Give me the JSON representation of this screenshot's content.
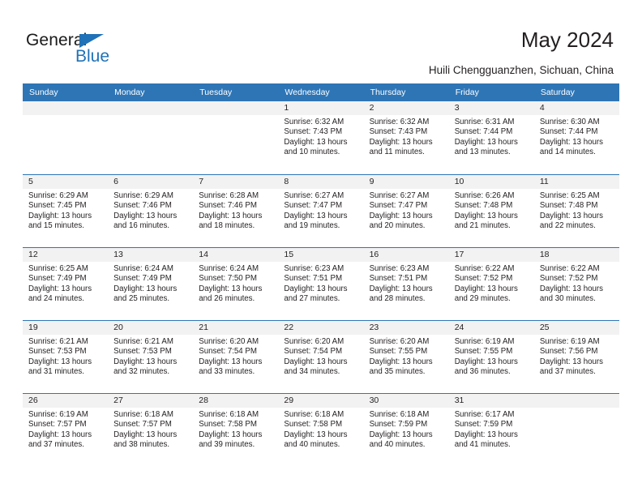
{
  "brand": {
    "name_top": "General",
    "name_bottom": "Blue",
    "accent_color": "#1f72b8"
  },
  "header": {
    "title": "May 2024",
    "subtitle": "Huili Chengguanzhen, Sichuan, China"
  },
  "theme": {
    "header_blue": "#2e75b6",
    "daynum_band": "#f2f2f2",
    "text": "#231f20"
  },
  "weekday_headers": [
    "Sunday",
    "Monday",
    "Tuesday",
    "Wednesday",
    "Thursday",
    "Friday",
    "Saturday"
  ],
  "weeks": [
    [
      {
        "day": "",
        "sunrise": "",
        "sunset": "",
        "daylight_line1": "",
        "daylight_line2": ""
      },
      {
        "day": "",
        "sunrise": "",
        "sunset": "",
        "daylight_line1": "",
        "daylight_line2": ""
      },
      {
        "day": "",
        "sunrise": "",
        "sunset": "",
        "daylight_line1": "",
        "daylight_line2": ""
      },
      {
        "day": "1",
        "sunrise": "Sunrise: 6:32 AM",
        "sunset": "Sunset: 7:43 PM",
        "daylight_line1": "Daylight: 13 hours",
        "daylight_line2": "and 10 minutes."
      },
      {
        "day": "2",
        "sunrise": "Sunrise: 6:32 AM",
        "sunset": "Sunset: 7:43 PM",
        "daylight_line1": "Daylight: 13 hours",
        "daylight_line2": "and 11 minutes."
      },
      {
        "day": "3",
        "sunrise": "Sunrise: 6:31 AM",
        "sunset": "Sunset: 7:44 PM",
        "daylight_line1": "Daylight: 13 hours",
        "daylight_line2": "and 13 minutes."
      },
      {
        "day": "4",
        "sunrise": "Sunrise: 6:30 AM",
        "sunset": "Sunset: 7:44 PM",
        "daylight_line1": "Daylight: 13 hours",
        "daylight_line2": "and 14 minutes."
      }
    ],
    [
      {
        "day": "5",
        "sunrise": "Sunrise: 6:29 AM",
        "sunset": "Sunset: 7:45 PM",
        "daylight_line1": "Daylight: 13 hours",
        "daylight_line2": "and 15 minutes."
      },
      {
        "day": "6",
        "sunrise": "Sunrise: 6:29 AM",
        "sunset": "Sunset: 7:46 PM",
        "daylight_line1": "Daylight: 13 hours",
        "daylight_line2": "and 16 minutes."
      },
      {
        "day": "7",
        "sunrise": "Sunrise: 6:28 AM",
        "sunset": "Sunset: 7:46 PM",
        "daylight_line1": "Daylight: 13 hours",
        "daylight_line2": "and 18 minutes."
      },
      {
        "day": "8",
        "sunrise": "Sunrise: 6:27 AM",
        "sunset": "Sunset: 7:47 PM",
        "daylight_line1": "Daylight: 13 hours",
        "daylight_line2": "and 19 minutes."
      },
      {
        "day": "9",
        "sunrise": "Sunrise: 6:27 AM",
        "sunset": "Sunset: 7:47 PM",
        "daylight_line1": "Daylight: 13 hours",
        "daylight_line2": "and 20 minutes."
      },
      {
        "day": "10",
        "sunrise": "Sunrise: 6:26 AM",
        "sunset": "Sunset: 7:48 PM",
        "daylight_line1": "Daylight: 13 hours",
        "daylight_line2": "and 21 minutes."
      },
      {
        "day": "11",
        "sunrise": "Sunrise: 6:25 AM",
        "sunset": "Sunset: 7:48 PM",
        "daylight_line1": "Daylight: 13 hours",
        "daylight_line2": "and 22 minutes."
      }
    ],
    [
      {
        "day": "12",
        "sunrise": "Sunrise: 6:25 AM",
        "sunset": "Sunset: 7:49 PM",
        "daylight_line1": "Daylight: 13 hours",
        "daylight_line2": "and 24 minutes."
      },
      {
        "day": "13",
        "sunrise": "Sunrise: 6:24 AM",
        "sunset": "Sunset: 7:49 PM",
        "daylight_line1": "Daylight: 13 hours",
        "daylight_line2": "and 25 minutes."
      },
      {
        "day": "14",
        "sunrise": "Sunrise: 6:24 AM",
        "sunset": "Sunset: 7:50 PM",
        "daylight_line1": "Daylight: 13 hours",
        "daylight_line2": "and 26 minutes."
      },
      {
        "day": "15",
        "sunrise": "Sunrise: 6:23 AM",
        "sunset": "Sunset: 7:51 PM",
        "daylight_line1": "Daylight: 13 hours",
        "daylight_line2": "and 27 minutes."
      },
      {
        "day": "16",
        "sunrise": "Sunrise: 6:23 AM",
        "sunset": "Sunset: 7:51 PM",
        "daylight_line1": "Daylight: 13 hours",
        "daylight_line2": "and 28 minutes."
      },
      {
        "day": "17",
        "sunrise": "Sunrise: 6:22 AM",
        "sunset": "Sunset: 7:52 PM",
        "daylight_line1": "Daylight: 13 hours",
        "daylight_line2": "and 29 minutes."
      },
      {
        "day": "18",
        "sunrise": "Sunrise: 6:22 AM",
        "sunset": "Sunset: 7:52 PM",
        "daylight_line1": "Daylight: 13 hours",
        "daylight_line2": "and 30 minutes."
      }
    ],
    [
      {
        "day": "19",
        "sunrise": "Sunrise: 6:21 AM",
        "sunset": "Sunset: 7:53 PM",
        "daylight_line1": "Daylight: 13 hours",
        "daylight_line2": "and 31 minutes."
      },
      {
        "day": "20",
        "sunrise": "Sunrise: 6:21 AM",
        "sunset": "Sunset: 7:53 PM",
        "daylight_line1": "Daylight: 13 hours",
        "daylight_line2": "and 32 minutes."
      },
      {
        "day": "21",
        "sunrise": "Sunrise: 6:20 AM",
        "sunset": "Sunset: 7:54 PM",
        "daylight_line1": "Daylight: 13 hours",
        "daylight_line2": "and 33 minutes."
      },
      {
        "day": "22",
        "sunrise": "Sunrise: 6:20 AM",
        "sunset": "Sunset: 7:54 PM",
        "daylight_line1": "Daylight: 13 hours",
        "daylight_line2": "and 34 minutes."
      },
      {
        "day": "23",
        "sunrise": "Sunrise: 6:20 AM",
        "sunset": "Sunset: 7:55 PM",
        "daylight_line1": "Daylight: 13 hours",
        "daylight_line2": "and 35 minutes."
      },
      {
        "day": "24",
        "sunrise": "Sunrise: 6:19 AM",
        "sunset": "Sunset: 7:55 PM",
        "daylight_line1": "Daylight: 13 hours",
        "daylight_line2": "and 36 minutes."
      },
      {
        "day": "25",
        "sunrise": "Sunrise: 6:19 AM",
        "sunset": "Sunset: 7:56 PM",
        "daylight_line1": "Daylight: 13 hours",
        "daylight_line2": "and 37 minutes."
      }
    ],
    [
      {
        "day": "26",
        "sunrise": "Sunrise: 6:19 AM",
        "sunset": "Sunset: 7:57 PM",
        "daylight_line1": "Daylight: 13 hours",
        "daylight_line2": "and 37 minutes."
      },
      {
        "day": "27",
        "sunrise": "Sunrise: 6:18 AM",
        "sunset": "Sunset: 7:57 PM",
        "daylight_line1": "Daylight: 13 hours",
        "daylight_line2": "and 38 minutes."
      },
      {
        "day": "28",
        "sunrise": "Sunrise: 6:18 AM",
        "sunset": "Sunset: 7:58 PM",
        "daylight_line1": "Daylight: 13 hours",
        "daylight_line2": "and 39 minutes."
      },
      {
        "day": "29",
        "sunrise": "Sunrise: 6:18 AM",
        "sunset": "Sunset: 7:58 PM",
        "daylight_line1": "Daylight: 13 hours",
        "daylight_line2": "and 40 minutes."
      },
      {
        "day": "30",
        "sunrise": "Sunrise: 6:18 AM",
        "sunset": "Sunset: 7:59 PM",
        "daylight_line1": "Daylight: 13 hours",
        "daylight_line2": "and 40 minutes."
      },
      {
        "day": "31",
        "sunrise": "Sunrise: 6:17 AM",
        "sunset": "Sunset: 7:59 PM",
        "daylight_line1": "Daylight: 13 hours",
        "daylight_line2": "and 41 minutes."
      },
      {
        "day": "",
        "sunrise": "",
        "sunset": "",
        "daylight_line1": "",
        "daylight_line2": ""
      }
    ]
  ]
}
